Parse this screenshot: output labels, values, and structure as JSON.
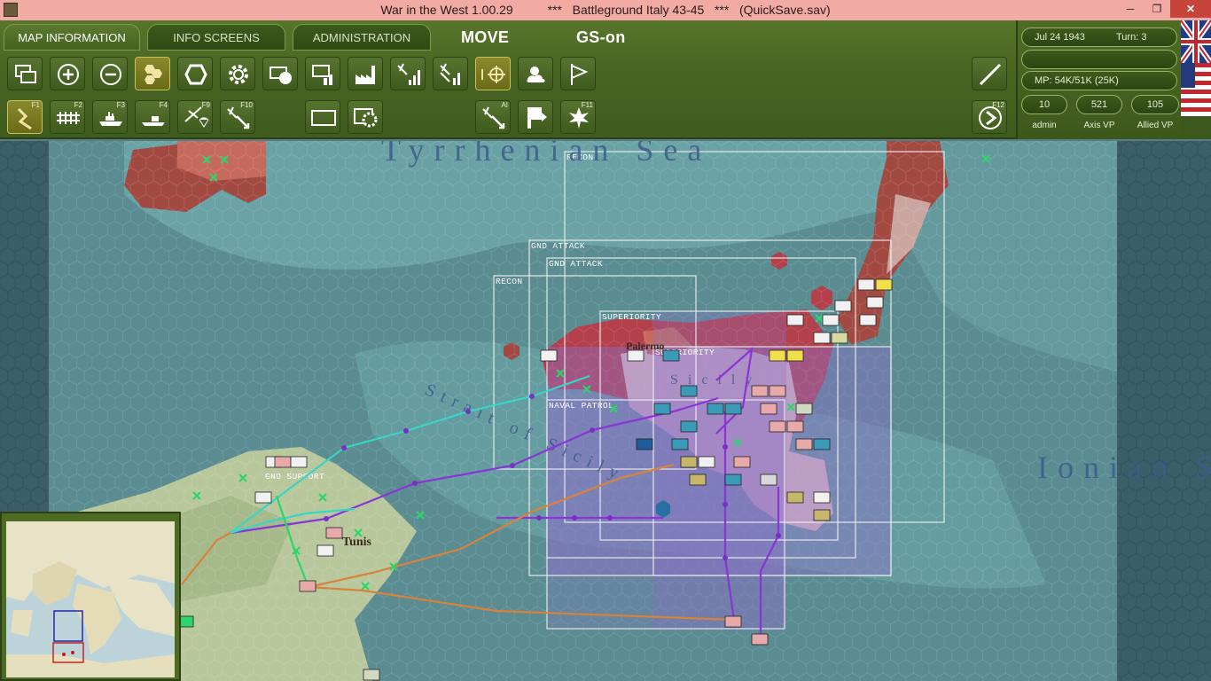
{
  "window": {
    "title": "War in the West 1.00.29          ***   Battleground Italy 43-45   ***   (QuickSave.sav)",
    "minimize_icon": "minimize-icon",
    "restore_icon": "restore-icon",
    "close_icon": "close-icon",
    "close_label": "✕"
  },
  "tabs": [
    {
      "label": "MAP INFORMATION",
      "active": true
    },
    {
      "label": "INFO SCREENS",
      "active": false
    },
    {
      "label": "ADMINISTRATION",
      "active": false
    }
  ],
  "mode": {
    "move": "MOVE",
    "gs": "GS-on"
  },
  "toolbar": {
    "row1": [
      "toggle-windows-icon",
      "zoom-in-icon",
      "zoom-out-icon",
      "hex-grid-icon",
      "hex-frame-icon",
      "settings-gear-icon",
      "unit-counter-icon",
      "bar-info-icon",
      "factory-icon",
      "air-signal-icon",
      "air-signal-2-icon",
      "target-icon",
      "weather-icon",
      "flag-icon",
      "draw-line-icon"
    ],
    "row2": [
      {
        "icon": "path-arrow-icon",
        "key": "F1"
      },
      {
        "icon": "rail-icon",
        "key": "F2"
      },
      {
        "icon": "naval-ship-icon",
        "key": "F3"
      },
      {
        "icon": "naval-transport-icon",
        "key": "F4"
      },
      {
        "icon": "air-drop-icon",
        "key": "F9"
      },
      {
        "icon": "air-strike-icon",
        "key": "F10"
      },
      {
        "icon": "rectangle-select-icon",
        "key": ""
      },
      {
        "icon": "hex-gear-icon",
        "key": ""
      },
      {
        "icon": "air-ai-icon",
        "key": "AI"
      },
      {
        "icon": "move-flag-icon",
        "key": ""
      },
      {
        "icon": "explosion-icon",
        "key": "F11"
      },
      {
        "icon": "end-turn-icon",
        "key": "F12"
      }
    ]
  },
  "status": {
    "date": "Jul 24 1943",
    "turn": "Turn: 3",
    "mp": "MP:  54K/51K (25K)",
    "admin_value": "10",
    "admin_label": "admin",
    "axis_vp_value": "521",
    "axis_vp_label": "Axis VP",
    "allied_vp_value": "105",
    "allied_vp_label": "Allied VP"
  },
  "map": {
    "sea_labels": [
      "Tyrrhenian Sea",
      "Ionian S",
      "Strait of Sicily"
    ],
    "towns": [
      "Palermo",
      "Tunis",
      "Sicily"
    ],
    "mission_labels": [
      "RECON",
      "GND ATTACK",
      "GND ATTACK",
      "RECON",
      "SUPERIORITY",
      "SUPERIORITY",
      "NAVAL PATROL",
      "GND SUPPORT"
    ]
  },
  "colors": {
    "sea": "#5a8c92",
    "deep_sea": "#3c5e68",
    "land": "#b8c89c",
    "axis_territory": "#b3404a",
    "air_zone": "#8b6fc8",
    "route_cyan": "#38d6c4",
    "route_purple": "#8a33d6",
    "route_orange": "#d9823c",
    "toolbar_green": "#4a6623"
  }
}
